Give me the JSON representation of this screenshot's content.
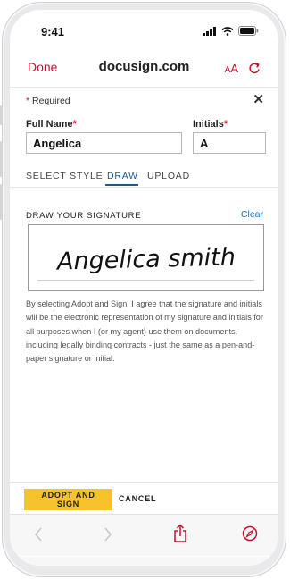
{
  "status_bar": {
    "time": "9:41"
  },
  "browser": {
    "done_label": "Done",
    "url": "docusign.com",
    "text_size_label_big": "A",
    "text_size_label_small": "A"
  },
  "form": {
    "required_star": "*",
    "required_text": " Required",
    "close_symbol": "✕",
    "full_name_label": "Full Name",
    "initials_label": "Initials",
    "label_star": "*",
    "full_name_value": "Angelica",
    "initials_value": "A"
  },
  "tabs": [
    {
      "label": "SELECT STYLE"
    },
    {
      "label": "DRAW"
    },
    {
      "label": "UPLOAD"
    }
  ],
  "signature": {
    "section_label": "DRAW YOUR SIGNATURE",
    "clear_label": "Clear",
    "signature_text": "Angelica smith"
  },
  "legal_text": "By selecting Adopt and Sign, I agree that the signature and initials will be the electronic representation of my signature and initials for all purposes when I (or my agent) use them on documents, including legally binding contracts - just the same as a pen-and-paper signature or initial.",
  "actions": {
    "adopt_label": "ADOPT AND SIGN",
    "cancel_label": "CANCEL"
  },
  "icons": {
    "reload": "reload-icon",
    "back": "chevron-left-icon",
    "forward": "chevron-right-icon",
    "share": "share-icon",
    "compass": "compass-icon"
  },
  "colors": {
    "accent_red": "#c8102e",
    "tab_active": "#1e5a8c",
    "link_blue": "#1a73b8",
    "adopt_yellow": "#f7c22b"
  }
}
